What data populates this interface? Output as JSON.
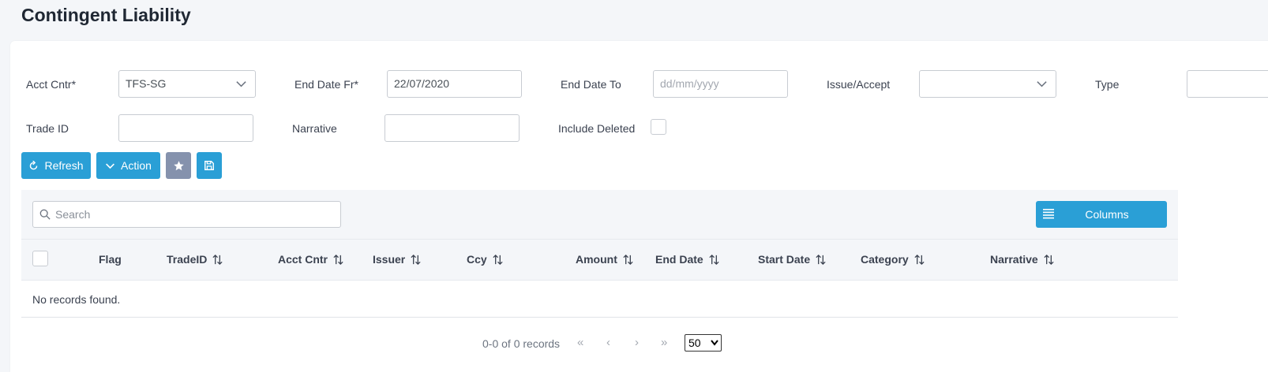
{
  "page": {
    "title": "Contingent Liability"
  },
  "filters": {
    "acct_cntr": {
      "label": "Acct Cntr*",
      "value": "TFS-SG"
    },
    "end_date_fr": {
      "label": "End Date Fr*",
      "value": "22/07/2020"
    },
    "end_date_to": {
      "label": "End Date To",
      "placeholder": "dd/mm/yyyy"
    },
    "issue_accept": {
      "label": "Issue/Accept",
      "value": ""
    },
    "type": {
      "label": "Type",
      "value": ""
    },
    "trade_id": {
      "label": "Trade ID",
      "value": ""
    },
    "narrative": {
      "label": "Narrative",
      "value": ""
    },
    "include_deleted": {
      "label": "Include Deleted",
      "checked": false
    }
  },
  "actions": {
    "refresh_label": "Refresh",
    "action_label": "Action",
    "favorite_icon": "star-icon",
    "save_icon": "save-icon"
  },
  "table": {
    "search_placeholder": "Search",
    "columns_button": "Columns",
    "headers": [
      "Flag",
      "TradeID",
      "Acct Cntr",
      "Issuer",
      "Ccy",
      "Amount",
      "End Date",
      "Start Date",
      "Category",
      "Narrative"
    ],
    "empty_message": "No records found."
  },
  "pagination": {
    "summary": "0-0 of 0 records",
    "rows_per_page": "50"
  },
  "colors": {
    "primary": "#2a9fd6",
    "secondary": "#8592ad",
    "background": "#f4f6f9"
  }
}
